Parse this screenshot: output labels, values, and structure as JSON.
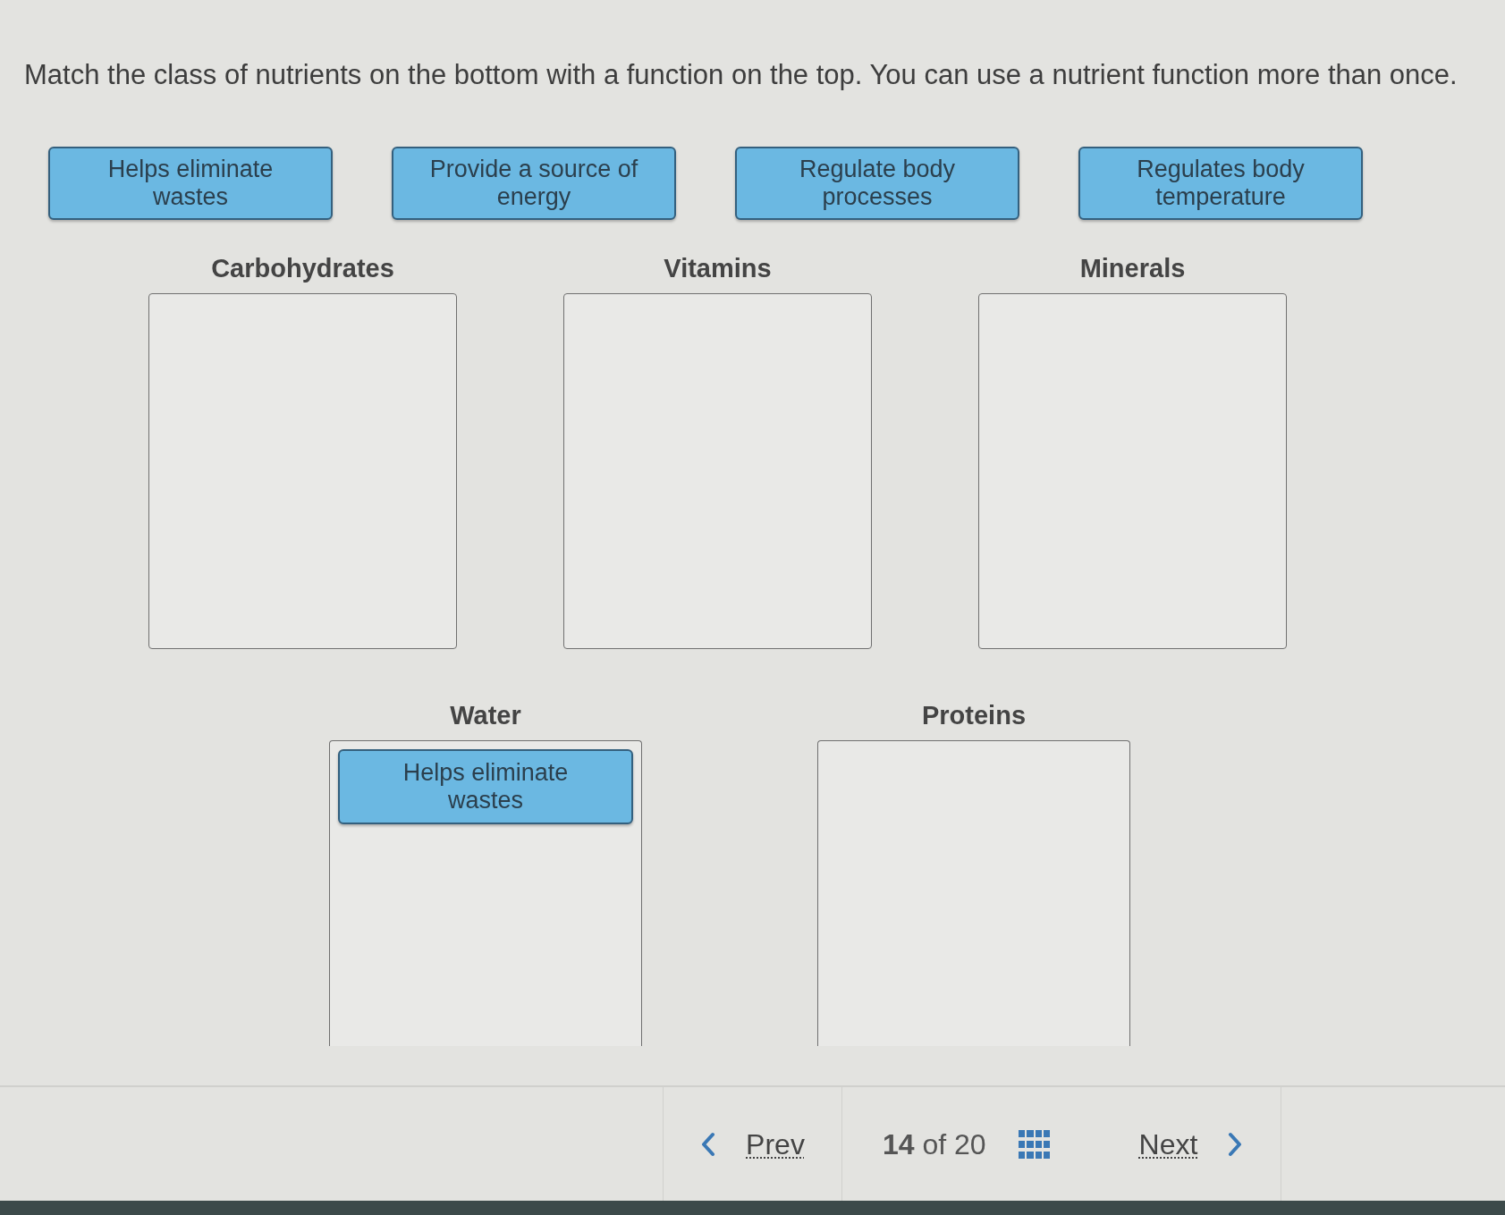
{
  "instructions": "Match the class of nutrients on the bottom with a function on the top. You can use a nutrient function more than once.",
  "answer_options": [
    {
      "label": "Helps eliminate wastes"
    },
    {
      "label": "Provide a source of energy"
    },
    {
      "label": "Regulate body processes"
    },
    {
      "label": "Regulates body temperature"
    }
  ],
  "drop_rows": [
    {
      "categories": [
        {
          "label": "Carbohydrates"
        },
        {
          "label": "Vitamins"
        },
        {
          "label": "Minerals"
        }
      ]
    },
    {
      "categories": [
        {
          "label": "Water",
          "placed": [
            {
              "label": "Helps eliminate wastes"
            }
          ]
        },
        {
          "label": "Proteins"
        }
      ]
    }
  ],
  "footer": {
    "prev": "Prev",
    "position": "**14** of 20",
    "next": "Next"
  }
}
